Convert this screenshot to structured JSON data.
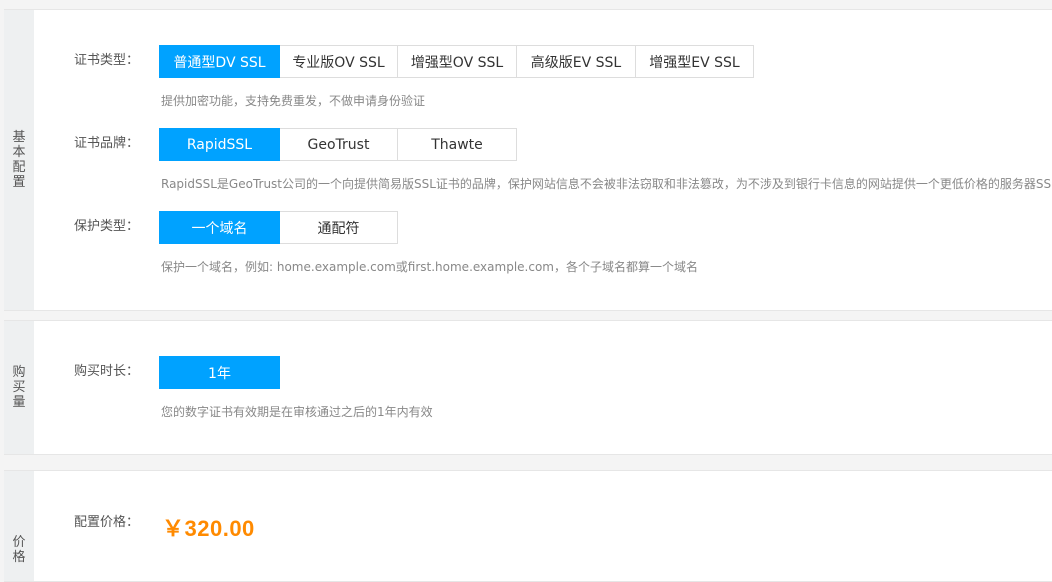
{
  "basic": {
    "side_label": "基本配置",
    "cert_type": {
      "label": "证书类型：",
      "options": [
        "普通型DV SSL",
        "专业版OV SSL",
        "增强型OV SSL",
        "高级版EV SSL",
        "增强型EV SSL"
      ],
      "selected": 0,
      "hint": "提供加密功能，支持免费重发，不做申请身份验证"
    },
    "cert_brand": {
      "label": "证书品牌：",
      "options": [
        "RapidSSL",
        "GeoTrust",
        "Thawte"
      ],
      "selected": 0,
      "hint": "RapidSSL是GeoTrust公司的一个向提供简易版SSL证书的品牌，保护网站信息不会被非法窃取和非法篡改，为不涉及到银行卡信息的网站提供一个更低价格的服务器SSL证"
    },
    "protect_type": {
      "label": "保护类型：",
      "options": [
        "一个域名",
        "通配符"
      ],
      "selected": 0,
      "hint": "保护一个域名，例如: home.example.com或first.home.example.com，各个子域名都算一个域名"
    }
  },
  "purchase": {
    "side_label": "购买量",
    "duration": {
      "label": "购买时长：",
      "options": [
        "1年"
      ],
      "selected": 0,
      "hint": "您的数字证书有效期是在审核通过之后的1年内有效"
    }
  },
  "pricing": {
    "side_label": "价格",
    "label": "配置价格：",
    "price": "￥320.00"
  },
  "colors": {
    "accent": "#00a2ff",
    "price": "#ff8a00"
  }
}
